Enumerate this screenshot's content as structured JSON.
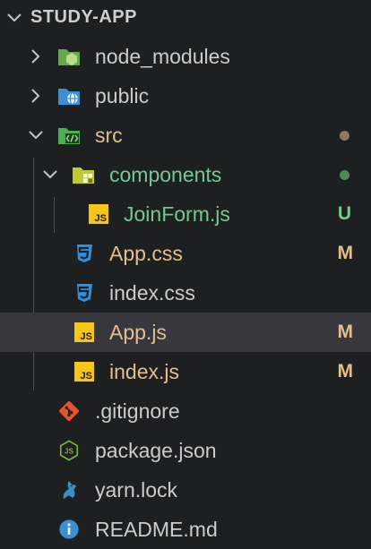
{
  "explorer": {
    "title": "STUDY-APP"
  },
  "colors": {
    "background": "#1e1f20",
    "selected_row": "#37373d",
    "modified": "#e2c08d",
    "untracked": "#73c991",
    "default_text": "#cccccc"
  },
  "tree": [
    {
      "label": "node_modules",
      "type": "folder",
      "icon": "node-folder-icon",
      "expanded": false,
      "badge": ""
    },
    {
      "label": "public",
      "type": "folder",
      "icon": "globe-folder-icon",
      "expanded": false,
      "badge": ""
    },
    {
      "label": "src",
      "type": "folder",
      "icon": "src-folder-icon",
      "expanded": true,
      "badge": ""
    },
    {
      "label": "components",
      "type": "folder",
      "icon": "components-folder-icon",
      "expanded": true,
      "badge": ""
    },
    {
      "label": "JoinForm.js",
      "type": "file",
      "icon": "js-icon",
      "badge": "U"
    },
    {
      "label": "App.css",
      "type": "file",
      "icon": "css-icon",
      "badge": "M"
    },
    {
      "label": "index.css",
      "type": "file",
      "icon": "css-icon",
      "badge": ""
    },
    {
      "label": "App.js",
      "type": "file",
      "icon": "js-icon",
      "badge": "M",
      "selected": true
    },
    {
      "label": "index.js",
      "type": "file",
      "icon": "js-icon",
      "badge": "M"
    },
    {
      "label": ".gitignore",
      "type": "file",
      "icon": "git-icon",
      "badge": ""
    },
    {
      "label": "package.json",
      "type": "file",
      "icon": "nodejs-icon",
      "badge": ""
    },
    {
      "label": "yarn.lock",
      "type": "file",
      "icon": "yarn-icon",
      "badge": ""
    },
    {
      "label": "README.md",
      "type": "file",
      "icon": "info-icon",
      "badge": ""
    }
  ]
}
